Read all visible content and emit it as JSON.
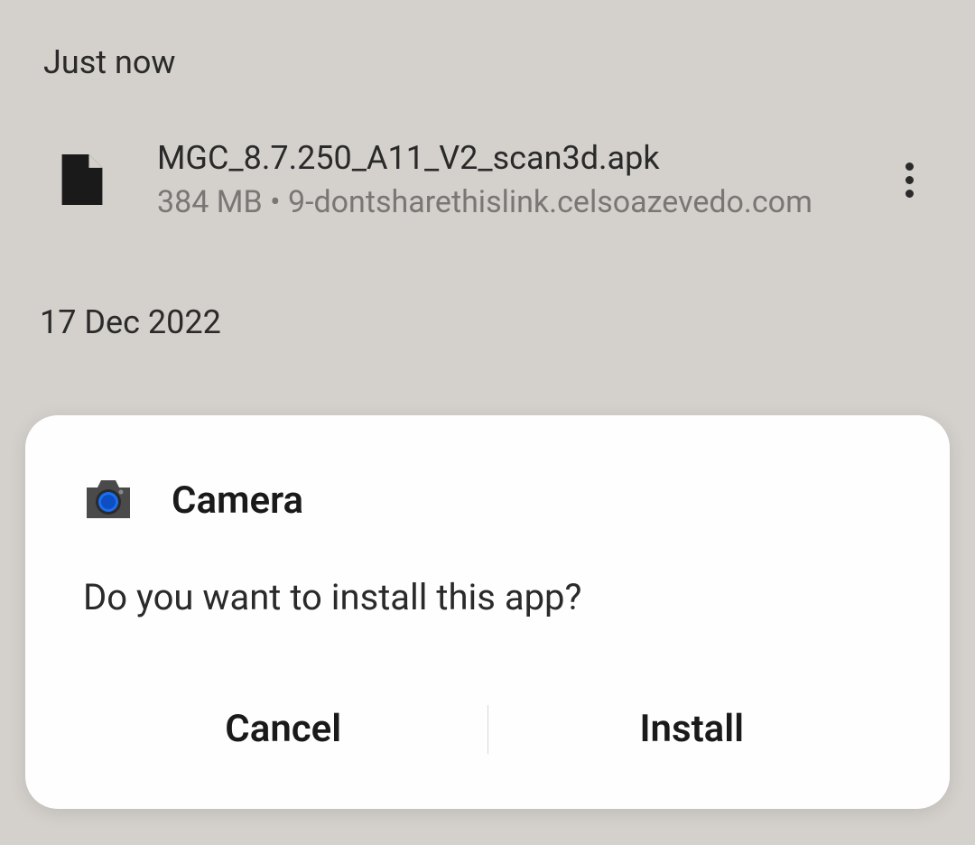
{
  "downloads": {
    "sections": [
      {
        "header": "Just now",
        "items": [
          {
            "name": "MGC_8.7.250_A11_V2_scan3d.apk",
            "size": "384 MB",
            "source": "9-dontsharethislink.celsoazevedo.com"
          }
        ]
      },
      {
        "header": "17 Dec 2022"
      }
    ]
  },
  "dialog": {
    "app_name": "Camera",
    "message": "Do you want to install this app?",
    "cancel_label": "Cancel",
    "install_label": "Install"
  }
}
